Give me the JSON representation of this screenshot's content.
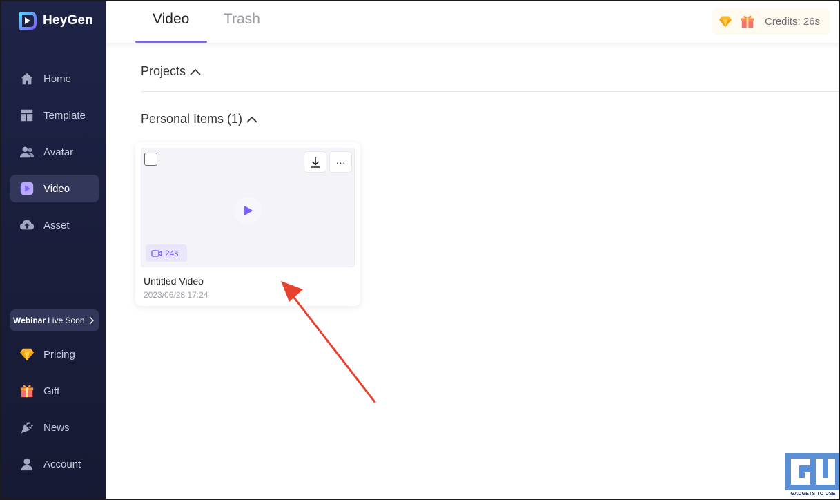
{
  "app": {
    "name": "HeyGen"
  },
  "sidebar": {
    "items": [
      {
        "label": "Home",
        "icon": "home-icon"
      },
      {
        "label": "Template",
        "icon": "template-icon"
      },
      {
        "label": "Avatar",
        "icon": "avatar-icon"
      },
      {
        "label": "Video",
        "icon": "video-play-icon",
        "active": true
      },
      {
        "label": "Asset",
        "icon": "cloud-upload-icon"
      }
    ],
    "webinar": {
      "strong": "Webinar",
      "rest": "Live Soon"
    },
    "bottom_items": [
      {
        "label": "Pricing",
        "icon": "diamond-icon"
      },
      {
        "label": "Gift",
        "icon": "gift-icon"
      },
      {
        "label": "News",
        "icon": "party-popper-icon"
      },
      {
        "label": "Account",
        "icon": "account-icon"
      }
    ]
  },
  "tabs": [
    {
      "label": "Video",
      "active": true
    },
    {
      "label": "Trash",
      "active": false
    }
  ],
  "header": {
    "credits": "Credits: 26s"
  },
  "sections": {
    "projects": "Projects",
    "personal": "Personal Items (1)"
  },
  "card": {
    "title": "Untitled Video",
    "date": "2023/06/28 17:24",
    "duration": "24s",
    "more": "···"
  },
  "watermark": {
    "text": "GADGETS TO USE"
  },
  "colors": {
    "accent": "#7b61ff",
    "sidebar_bg": "#1d2142",
    "annotation_arrow": "#e8412e"
  }
}
